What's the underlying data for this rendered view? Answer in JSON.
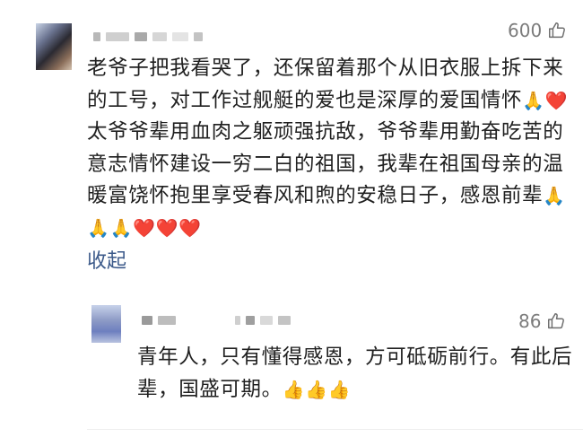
{
  "comment1": {
    "likes": "600",
    "text_main": "老爷子把我看哭了，还保留着那个从旧衣服上拆下来的工号，对工作过舰艇的爱也是深厚的爱国情怀",
    "emoji_a": "🙏❤️",
    "text_mid": "太爷爷辈用血肉之躯顽强抗敌，爷爷辈用勤奋吃苦的意志情怀建设一穷二白的祖国，我辈在祖国母亲的温暖富饶怀抱里享受春风和煦的安稳日子，感恩前辈",
    "emoji_b": "🙏🙏🙏❤️❤️❤️",
    "collapse_label": "收起"
  },
  "reply": {
    "likes": "86",
    "text": "青年人，只有懂得感恩，方可砥砺前行。有此后辈，国盛可期。",
    "emoji": "👍👍👍"
  },
  "colors": {
    "link": "#3c5a8a",
    "muted": "#7c7c7c"
  },
  "icons": {
    "like": "thumbs-up-outline-icon"
  }
}
